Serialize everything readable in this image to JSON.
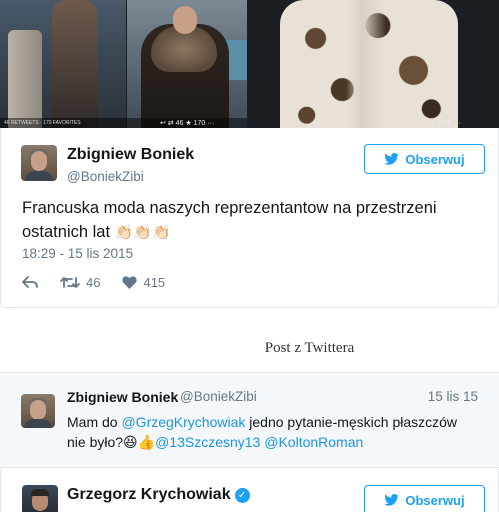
{
  "photo_strip": {
    "stats_left": "46 RETWEETS · 170 FAVORITES",
    "stats_mid": "↩  ⇄ 46 ★ 170 ···",
    "stats_right": "↩  ⇄  ★  ···"
  },
  "tweet": {
    "author_name": "Zbigniew Boniek",
    "author_handle": "@BoniekZibi",
    "follow_label": "Obserwuj",
    "text": "Francuska moda naszych reprezentantow na przestrzeni ostatnich lat",
    "emoji": [
      "👏🏻",
      "👏🏻",
      "👏🏻"
    ],
    "timestamp": "18:29 - 15 lis 2015",
    "retweets": "46",
    "likes": "415"
  },
  "caption": "Post z Twittera",
  "reply": {
    "author_name": "Zbigniew Boniek",
    "author_handle": "@BoniekZibi",
    "date": "15 lis 15",
    "text_before": "Mam do ",
    "mention_1": "@GrzegKrychowiak",
    "text_middle": " jedno pytanie-męskich płaszczów nie było?",
    "emoji": "😆👍",
    "mention_2": "@13Szczesny13",
    "mention_3": "@KoltonRoman"
  },
  "next_tweet": {
    "author_name": "Grzegorz Krychowiak",
    "verified": "✓",
    "follow_label": "Obserwuj"
  },
  "colors": {
    "accent": "#1da1f2",
    "muted": "#657786",
    "text": "#14171a",
    "reply_bg": "#f5f8fa"
  }
}
